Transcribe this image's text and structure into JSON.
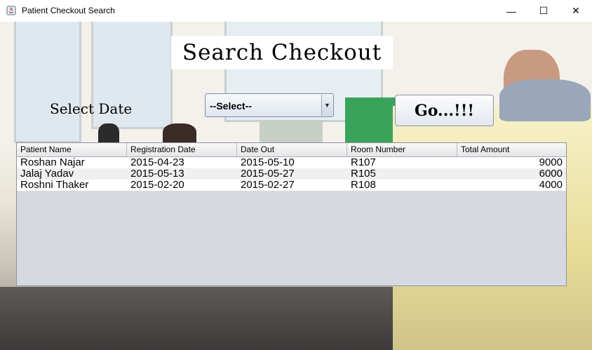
{
  "window": {
    "title": "Patient Checkout Search",
    "minimize_glyph": "—",
    "maximize_glyph": "☐",
    "close_glyph": "✕"
  },
  "heading": "Search Checkout",
  "filter": {
    "label": "Select Date",
    "selected": "--Select--",
    "arrow_glyph": "▼"
  },
  "go_button": "Go...!!!",
  "table": {
    "columns": [
      "Patient Name",
      "Registration Date",
      "Date Out",
      "Room Number",
      "Total Amount"
    ],
    "rows": [
      [
        "Roshan Najar",
        "2015-04-23",
        "2015-05-10",
        "R107",
        "9000"
      ],
      [
        "Jalaj Yadav",
        "2015-05-13",
        "2015-05-27",
        "R105",
        "6000"
      ],
      [
        "Roshni Thaker",
        "2015-02-20",
        "2015-02-27",
        "R108",
        "4000"
      ]
    ]
  }
}
